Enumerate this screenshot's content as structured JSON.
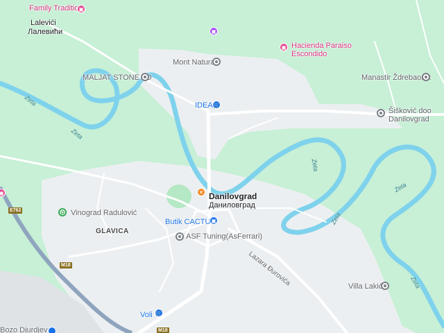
{
  "map": {
    "colors": {
      "land": "#c7f0d6",
      "urban": "#eceff1",
      "river": "#7fd2ec",
      "road": "#ffffff",
      "highway": "#8fa5be"
    },
    "places": {
      "family_tradition": "Family Tradition",
      "lalevici_latin": "Lalevići",
      "lalevici_cyr": "Лалевићи",
      "hacienda_line1": "Hacienda Paraiso",
      "hacienda_line2": "Escondido",
      "mont_natural": "Mont Natural",
      "maljat": "MALJAT STONE AD",
      "manastir": "Manastir Ždrebaonik",
      "idea": "IDEA",
      "siskovic_line1": "Šišković doo",
      "siskovic_line2": "Danilovgrad",
      "danilovgrad_latin": "Danilovgrad",
      "danilovgrad_cyr": "Даниловград",
      "vinograd": "Vinograd Radulović",
      "butik": "Butik CACTUS",
      "glavica": "GLAVICA",
      "asf": "ASF Tuning(AsFerrari)",
      "villa": "Villa Lakić",
      "voli": "Voli",
      "bozo": "Bozo Djurdjevac"
    },
    "rivers": {
      "zeta": "Zeta"
    },
    "roads": {
      "lazara": "Lazara Đurovića",
      "e762": "E762",
      "m18a": "M18",
      "m18b": "M18"
    }
  }
}
